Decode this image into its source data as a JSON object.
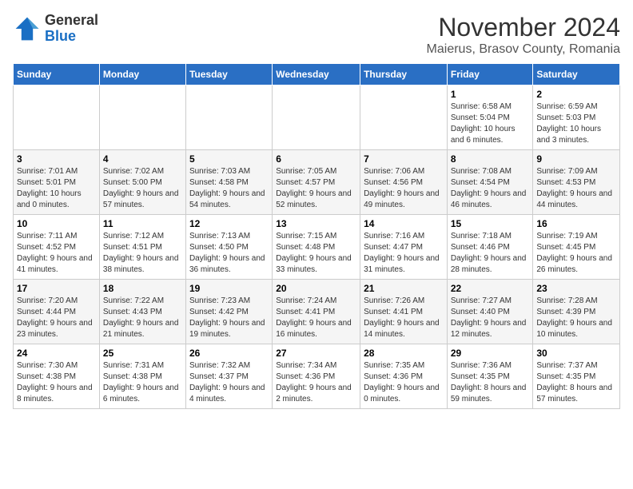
{
  "header": {
    "logo_general": "General",
    "logo_blue": "Blue",
    "month_title": "November 2024",
    "location": "Maierus, Brasov County, Romania"
  },
  "days_of_week": [
    "Sunday",
    "Monday",
    "Tuesday",
    "Wednesday",
    "Thursday",
    "Friday",
    "Saturday"
  ],
  "weeks": [
    [
      {
        "day": "",
        "info": ""
      },
      {
        "day": "",
        "info": ""
      },
      {
        "day": "",
        "info": ""
      },
      {
        "day": "",
        "info": ""
      },
      {
        "day": "",
        "info": ""
      },
      {
        "day": "1",
        "info": "Sunrise: 6:58 AM\nSunset: 5:04 PM\nDaylight: 10 hours and 6 minutes."
      },
      {
        "day": "2",
        "info": "Sunrise: 6:59 AM\nSunset: 5:03 PM\nDaylight: 10 hours and 3 minutes."
      }
    ],
    [
      {
        "day": "3",
        "info": "Sunrise: 7:01 AM\nSunset: 5:01 PM\nDaylight: 10 hours and 0 minutes."
      },
      {
        "day": "4",
        "info": "Sunrise: 7:02 AM\nSunset: 5:00 PM\nDaylight: 9 hours and 57 minutes."
      },
      {
        "day": "5",
        "info": "Sunrise: 7:03 AM\nSunset: 4:58 PM\nDaylight: 9 hours and 54 minutes."
      },
      {
        "day": "6",
        "info": "Sunrise: 7:05 AM\nSunset: 4:57 PM\nDaylight: 9 hours and 52 minutes."
      },
      {
        "day": "7",
        "info": "Sunrise: 7:06 AM\nSunset: 4:56 PM\nDaylight: 9 hours and 49 minutes."
      },
      {
        "day": "8",
        "info": "Sunrise: 7:08 AM\nSunset: 4:54 PM\nDaylight: 9 hours and 46 minutes."
      },
      {
        "day": "9",
        "info": "Sunrise: 7:09 AM\nSunset: 4:53 PM\nDaylight: 9 hours and 44 minutes."
      }
    ],
    [
      {
        "day": "10",
        "info": "Sunrise: 7:11 AM\nSunset: 4:52 PM\nDaylight: 9 hours and 41 minutes."
      },
      {
        "day": "11",
        "info": "Sunrise: 7:12 AM\nSunset: 4:51 PM\nDaylight: 9 hours and 38 minutes."
      },
      {
        "day": "12",
        "info": "Sunrise: 7:13 AM\nSunset: 4:50 PM\nDaylight: 9 hours and 36 minutes."
      },
      {
        "day": "13",
        "info": "Sunrise: 7:15 AM\nSunset: 4:48 PM\nDaylight: 9 hours and 33 minutes."
      },
      {
        "day": "14",
        "info": "Sunrise: 7:16 AM\nSunset: 4:47 PM\nDaylight: 9 hours and 31 minutes."
      },
      {
        "day": "15",
        "info": "Sunrise: 7:18 AM\nSunset: 4:46 PM\nDaylight: 9 hours and 28 minutes."
      },
      {
        "day": "16",
        "info": "Sunrise: 7:19 AM\nSunset: 4:45 PM\nDaylight: 9 hours and 26 minutes."
      }
    ],
    [
      {
        "day": "17",
        "info": "Sunrise: 7:20 AM\nSunset: 4:44 PM\nDaylight: 9 hours and 23 minutes."
      },
      {
        "day": "18",
        "info": "Sunrise: 7:22 AM\nSunset: 4:43 PM\nDaylight: 9 hours and 21 minutes."
      },
      {
        "day": "19",
        "info": "Sunrise: 7:23 AM\nSunset: 4:42 PM\nDaylight: 9 hours and 19 minutes."
      },
      {
        "day": "20",
        "info": "Sunrise: 7:24 AM\nSunset: 4:41 PM\nDaylight: 9 hours and 16 minutes."
      },
      {
        "day": "21",
        "info": "Sunrise: 7:26 AM\nSunset: 4:41 PM\nDaylight: 9 hours and 14 minutes."
      },
      {
        "day": "22",
        "info": "Sunrise: 7:27 AM\nSunset: 4:40 PM\nDaylight: 9 hours and 12 minutes."
      },
      {
        "day": "23",
        "info": "Sunrise: 7:28 AM\nSunset: 4:39 PM\nDaylight: 9 hours and 10 minutes."
      }
    ],
    [
      {
        "day": "24",
        "info": "Sunrise: 7:30 AM\nSunset: 4:38 PM\nDaylight: 9 hours and 8 minutes."
      },
      {
        "day": "25",
        "info": "Sunrise: 7:31 AM\nSunset: 4:38 PM\nDaylight: 9 hours and 6 minutes."
      },
      {
        "day": "26",
        "info": "Sunrise: 7:32 AM\nSunset: 4:37 PM\nDaylight: 9 hours and 4 minutes."
      },
      {
        "day": "27",
        "info": "Sunrise: 7:34 AM\nSunset: 4:36 PM\nDaylight: 9 hours and 2 minutes."
      },
      {
        "day": "28",
        "info": "Sunrise: 7:35 AM\nSunset: 4:36 PM\nDaylight: 9 hours and 0 minutes."
      },
      {
        "day": "29",
        "info": "Sunrise: 7:36 AM\nSunset: 4:35 PM\nDaylight: 8 hours and 59 minutes."
      },
      {
        "day": "30",
        "info": "Sunrise: 7:37 AM\nSunset: 4:35 PM\nDaylight: 8 hours and 57 minutes."
      }
    ]
  ]
}
